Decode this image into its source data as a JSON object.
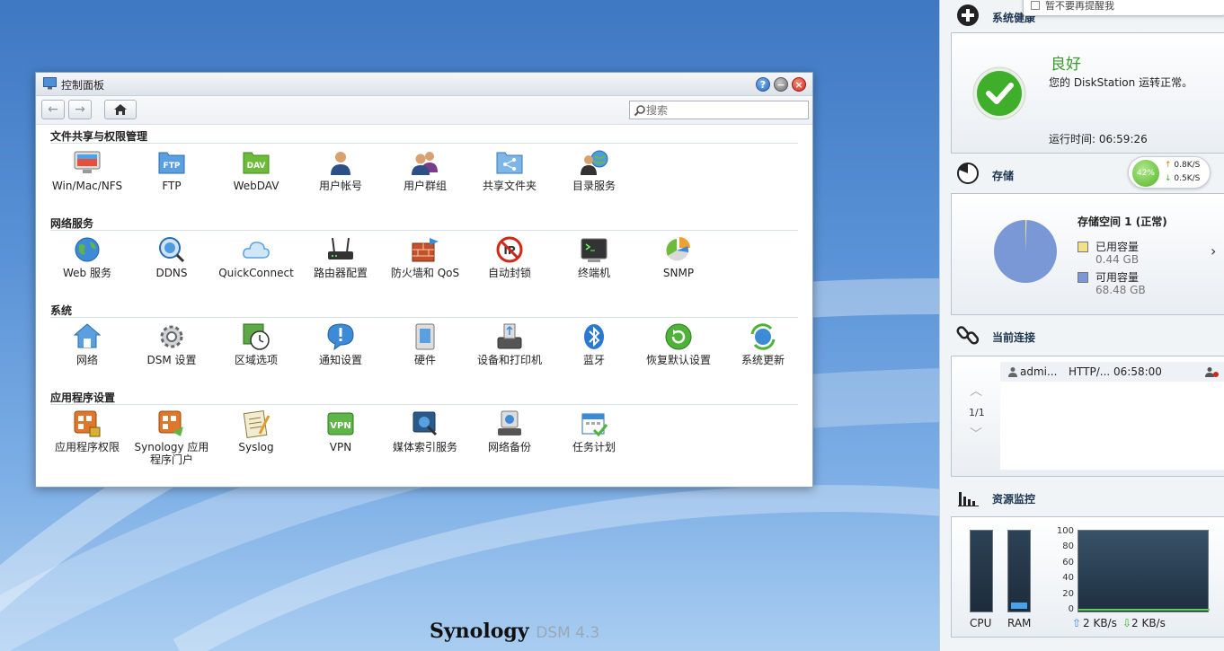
{
  "desktop": {
    "brand": "Synology",
    "product": "DSM 4.3"
  },
  "control_panel": {
    "title": "控制面板",
    "search_placeholder": "搜索",
    "sections": [
      {
        "title": "文件共享与权限管理",
        "items": [
          "Win/Mac/NFS",
          "FTP",
          "WebDAV",
          "用户帐号",
          "用户群组",
          "共享文件夹",
          "目录服务"
        ]
      },
      {
        "title": "网络服务",
        "items": [
          "Web 服务",
          "DDNS",
          "QuickConnect",
          "路由器配置",
          "防火墙和 QoS",
          "自动封锁",
          "终端机",
          "SNMP"
        ]
      },
      {
        "title": "系统",
        "items": [
          "网络",
          "DSM 设置",
          "区域选项",
          "通知设置",
          "硬件",
          "设备和打印机",
          "蓝牙",
          "恢复默认设置",
          "系统更新"
        ]
      },
      {
        "title": "应用程序设置",
        "items": [
          "应用程序权限",
          "Synology 应用程序门户",
          "Syslog",
          "VPN",
          "媒体索引服务",
          "网络备份",
          "任务计划"
        ]
      }
    ],
    "icon_badges": {
      "ftp": "FTP",
      "dav": "DAV",
      "vpn": "VPN"
    }
  },
  "widgets": {
    "system_health": {
      "title": "系统健康",
      "checkbox_label": "暂不要再提醒我",
      "status": "良好",
      "description": "您的 DiskStation 运转正常。",
      "uptime": "运行时间: 06:59:26"
    },
    "storage": {
      "title": "存储",
      "cpu_percent": "42%",
      "upload": "0.8K/S",
      "download": "0.5K/S",
      "volume": "存储空间 1 (正常)",
      "used_label": "已用容量",
      "used_value": "0.44 GB",
      "free_label": "可用容量",
      "free_value": "68.48 GB",
      "colors": {
        "used": "#f3e08a",
        "free": "#7b98d6"
      }
    },
    "connections": {
      "title": "当前连接",
      "page": "1/1",
      "rows": [
        {
          "user": "admi...",
          "type": "HTTP/...",
          "time": "06:58:00"
        }
      ]
    },
    "resource_monitor": {
      "title": "资源监控",
      "cpu_label": "CPU",
      "ram_label": "RAM",
      "cpu_level": 0.0,
      "ram_level": 0.08,
      "y_ticks": [
        "100",
        "80",
        "60",
        "40",
        "20",
        "0"
      ],
      "net_up": "2 KB/s",
      "net_down": "2 KB/s"
    }
  }
}
